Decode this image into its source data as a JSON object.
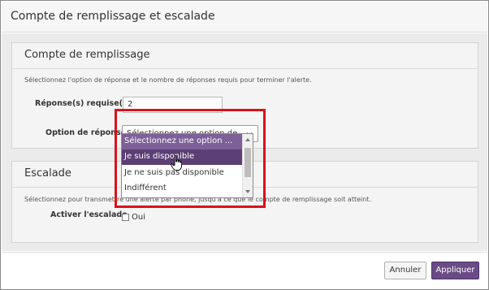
{
  "dialog": {
    "title": "Compte de remplissage et escalade"
  },
  "fill_section": {
    "title": "Compte de remplissage",
    "description": "Sélectionnez l'option de réponse et le nombre de réponses requis pour terminer l'alerte.",
    "responses_label": "Réponse(s) requise(s)",
    "responses_value": "2",
    "option_label": "Option de réponse",
    "select_value": "Sélectionnez une option de ...",
    "options": [
      {
        "label": "Sélectionnez une option ...",
        "state": "selected"
      },
      {
        "label": "Je suis disponible",
        "state": "hovered"
      },
      {
        "label": "Je ne suis pas disponible",
        "state": "normal"
      },
      {
        "label": "Indifférent",
        "state": "normal"
      }
    ]
  },
  "escalation_section": {
    "title": "Escalade",
    "description": "Sélectionnez pour transmettre une alerte par phone, jusqu'à ce que le compte de remplissage soit atteint.",
    "activate_label": "Activer l'escalade",
    "checkbox_label": "Oui",
    "checked": false
  },
  "footer": {
    "cancel_label": "Annuler",
    "apply_label": "Appliquer"
  },
  "colors": {
    "highlight": "#d8121b",
    "accent": "#6a4b85",
    "option_selected": "#7e6098",
    "option_hover": "#5c3f75"
  },
  "icons": {
    "select_arrow": "chevron-down-icon",
    "scroll_up": "arrow-up-icon",
    "scroll_down": "arrow-down-icon",
    "cursor": "hand-pointer-icon"
  }
}
